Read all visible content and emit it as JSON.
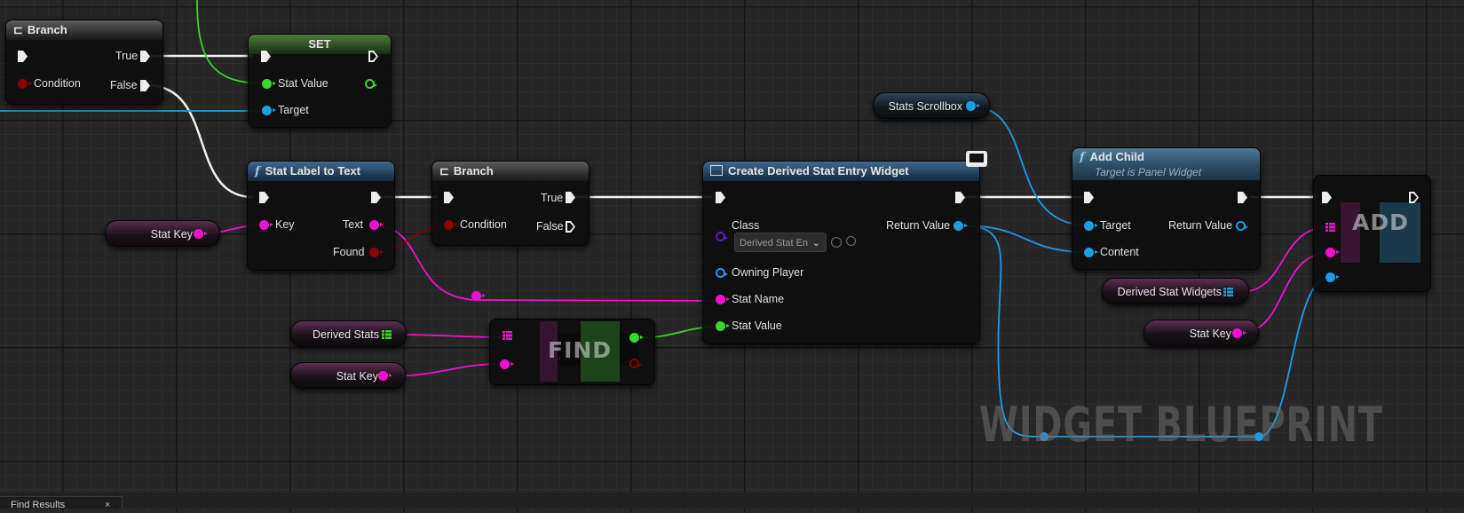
{
  "nodes": {
    "branch1": {
      "title": "Branch",
      "pins": {
        "true": "True",
        "condition": "Condition",
        "false": "False"
      }
    },
    "set": {
      "title": "SET",
      "pins": {
        "stat_value": "Stat Value",
        "target": "Target"
      }
    },
    "stat_label": {
      "title": "Stat Label to Text",
      "pins": {
        "key": "Key",
        "text": "Text",
        "found": "Found"
      }
    },
    "branch2": {
      "title": "Branch",
      "pins": {
        "true": "True",
        "condition": "Condition",
        "false": "False"
      }
    },
    "create_widget": {
      "title": "Create Derived Stat Entry Widget",
      "pins": {
        "class": "Class",
        "class_value": "Derived Stat En",
        "return_value": "Return Value",
        "owning_player": "Owning Player",
        "stat_name": "Stat Name",
        "stat_value": "Stat Value"
      }
    },
    "add_child": {
      "title": "Add Child",
      "subtitle": "Target is Panel Widget",
      "pins": {
        "target": "Target",
        "content": "Content",
        "return_value": "Return Value"
      }
    },
    "find": {
      "label": "FIND"
    },
    "add": {
      "label": "ADD"
    }
  },
  "variables": {
    "stat_key_1": "Stat Key",
    "derived_stats": "Derived Stats",
    "stat_key_2": "Stat Key",
    "stats_scrollbox": "Stats Scrollbox",
    "derived_stat_widgets": "Derived Stat Widgets",
    "stat_key_3": "Stat Key"
  },
  "watermark": "WIDGET BLUEPRINT",
  "bottom_tab": {
    "label": "Find Results",
    "close": "×"
  },
  "colors": {
    "exec": "#ededed",
    "bool": "#8f0000",
    "string": "#f010d0",
    "object": "#1e9ce6",
    "struct": "#3bd62a",
    "class": "#5e1fb6",
    "background": "#262626"
  }
}
